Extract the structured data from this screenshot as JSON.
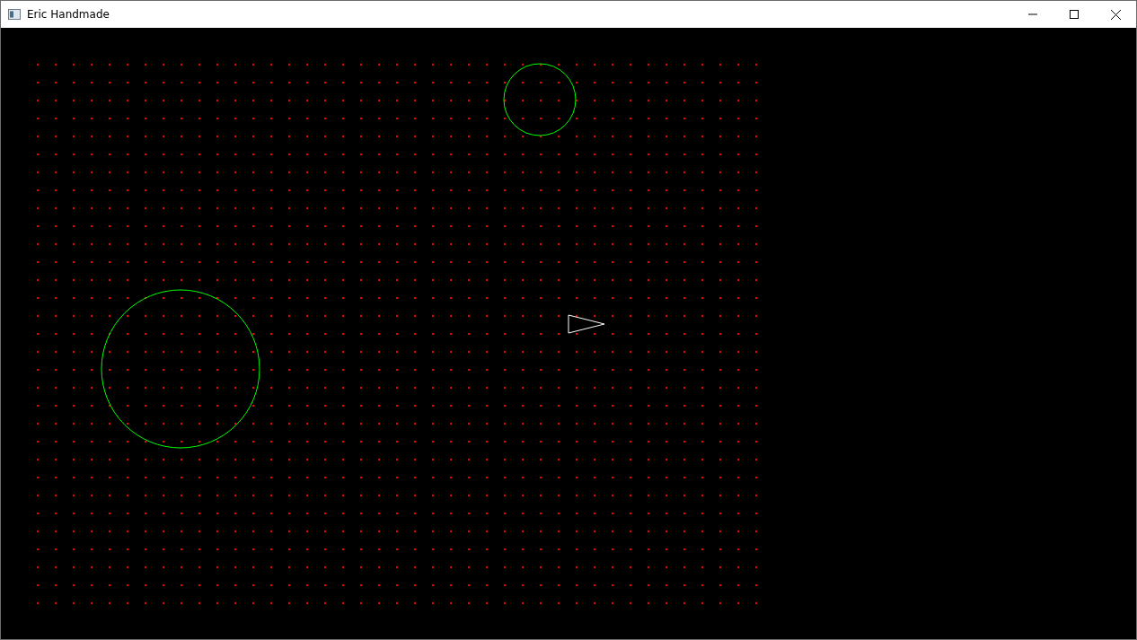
{
  "window": {
    "title": "Eric Handmade"
  }
}
